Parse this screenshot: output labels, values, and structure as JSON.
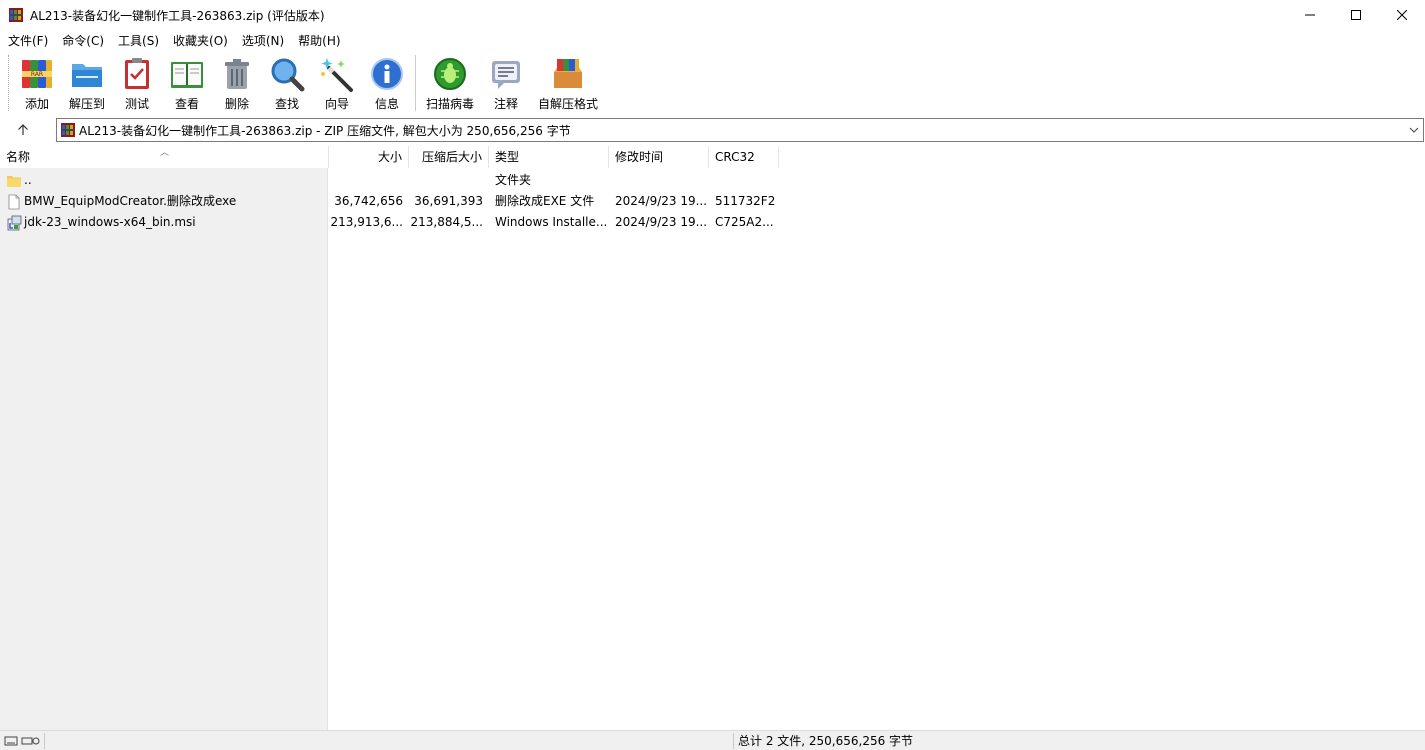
{
  "window": {
    "title": "AL213-装备幻化一键制作工具-263863.zip (评估版本)",
    "controls": {
      "minimize": "—",
      "maximize": "☐",
      "close": "✕"
    }
  },
  "menu": [
    "文件(F)",
    "命令(C)",
    "工具(S)",
    "收藏夹(O)",
    "选项(N)",
    "帮助(H)"
  ],
  "toolbar": {
    "add": "添加",
    "extract_to": "解压到",
    "test": "测试",
    "view": "查看",
    "delete": "删除",
    "find": "查找",
    "wizard": "向导",
    "info": "信息",
    "virus_scan": "扫描病毒",
    "comment": "注释",
    "sfx": "自解压格式"
  },
  "address": {
    "up_icon": "up-arrow-icon",
    "path": "AL213-装备幻化一键制作工具-263863.zip - ZIP 压缩文件, 解包大小为 250,656,256 字节"
  },
  "columns": {
    "name": "名称",
    "size": "大小",
    "packed": "压缩后大小",
    "type": "类型",
    "modified": "修改时间",
    "crc": "CRC32"
  },
  "files": [
    {
      "name": "..",
      "size": "",
      "packed": "",
      "type": "文件夹",
      "modified": "",
      "crc": "",
      "icon": "folder-icon"
    },
    {
      "name": "BMW_EquipModCreator.删除改成exe",
      "size": "36,742,656",
      "packed": "36,691,393",
      "type": "删除改成EXE 文件",
      "modified": "2024/9/23 19...",
      "crc": "511732F2",
      "icon": "file-icon"
    },
    {
      "name": "jdk-23_windows-x64_bin.msi",
      "size": "213,913,6...",
      "packed": "213,884,5...",
      "type": "Windows Installe...",
      "modified": "2024/9/23 19...",
      "crc": "C725A2...",
      "icon": "msi-icon"
    }
  ],
  "status": {
    "summary": "总计 2 文件, 250,656,256 字节"
  }
}
